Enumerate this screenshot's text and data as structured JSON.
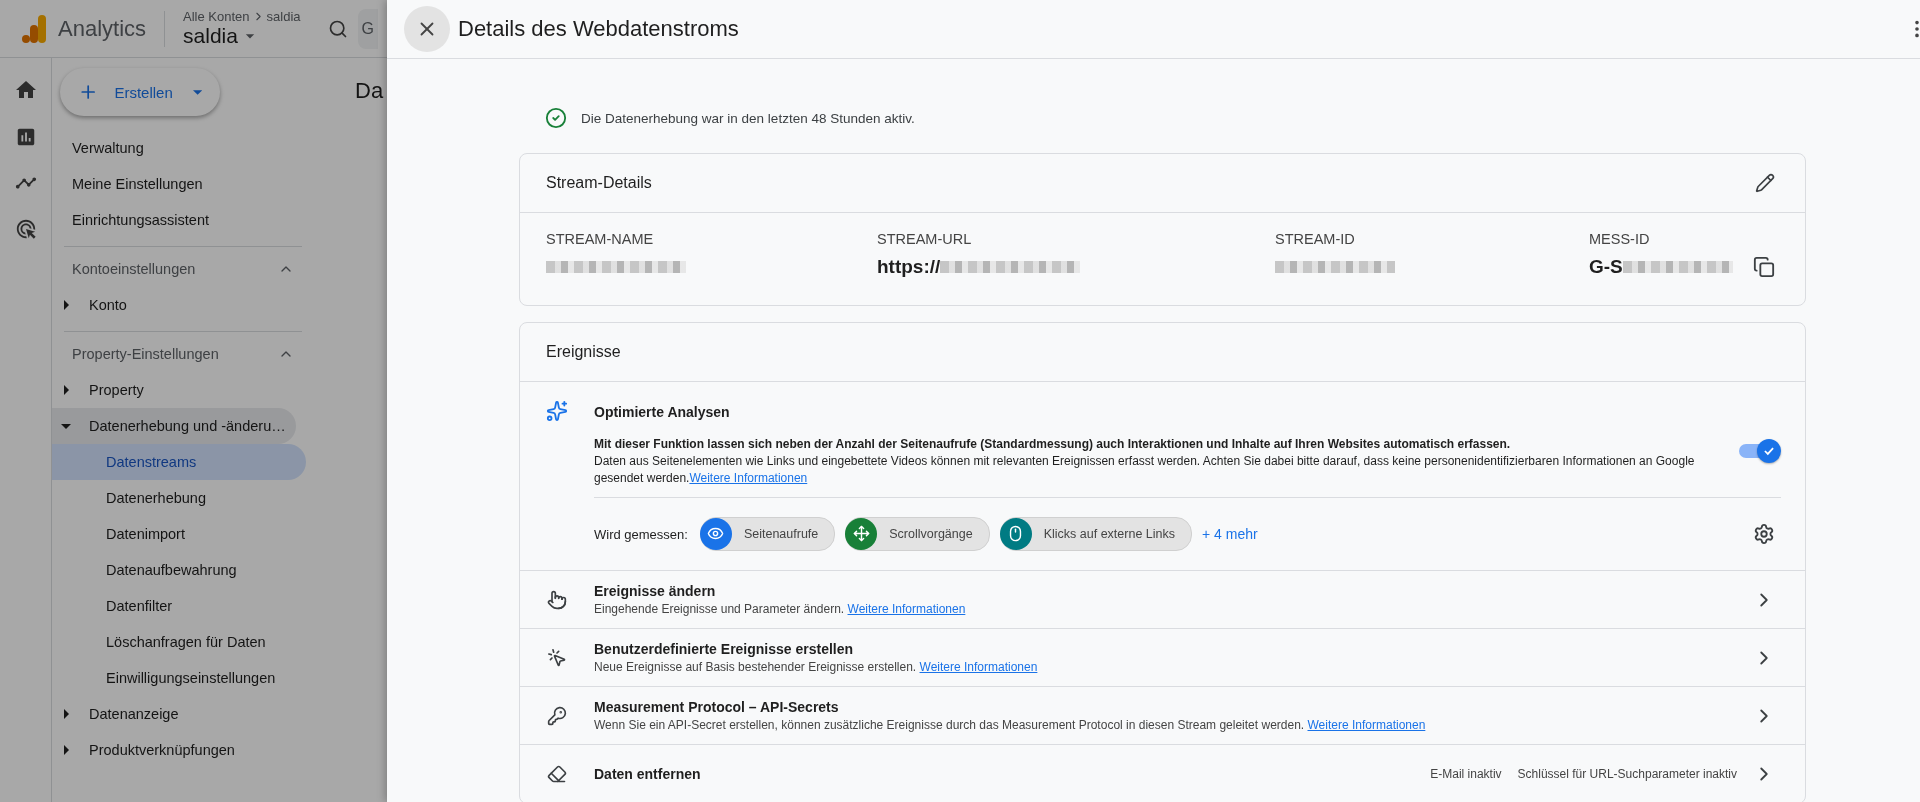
{
  "app": {
    "name": "Analytics",
    "breadcrumb": [
      "Alle Konten",
      "saldia"
    ],
    "property": "saldia",
    "search_fragment": "G"
  },
  "create_button": {
    "label": "Erstellen"
  },
  "nav": {
    "top_items": [
      "Verwaltung",
      "Meine Einstellungen",
      "Einrichtungsassistent"
    ],
    "sections": [
      {
        "title": "Kontoeinstellungen",
        "expanded": true,
        "items": [
          {
            "label": "Konto",
            "expanded": false
          }
        ]
      },
      {
        "title": "Property-Einstellungen",
        "expanded": true,
        "items": [
          {
            "label": "Property",
            "expanded": false
          },
          {
            "label": "Datenerhebung und -änderu…",
            "expanded": true,
            "children": [
              {
                "label": "Datenstreams",
                "selected": true
              },
              {
                "label": "Datenerhebung",
                "selected": false
              },
              {
                "label": "Datenimport",
                "selected": false
              },
              {
                "label": "Datenaufbewahrung",
                "selected": false
              },
              {
                "label": "Datenfilter",
                "selected": false
              },
              {
                "label": "Löschanfragen für Daten",
                "selected": false
              },
              {
                "label": "Einwilligungseinstellungen",
                "selected": false
              }
            ]
          },
          {
            "label": "Datenanzeige",
            "expanded": false
          },
          {
            "label": "Produktverknüpfungen",
            "expanded": false
          }
        ]
      }
    ]
  },
  "background_page": {
    "title_fragment": "Da"
  },
  "panel": {
    "title": "Details des Webdatenstroms",
    "status": "Die Datenerhebung war in den letzten 48 Stunden aktiv.",
    "stream_details": {
      "title": "Stream-Details",
      "fields": [
        {
          "label": "STREAM-NAME"
        },
        {
          "label": "STREAM-URL",
          "value": "https://"
        },
        {
          "label": "STREAM-ID"
        },
        {
          "label": "MESS-ID",
          "value": "G-S"
        }
      ]
    },
    "events": {
      "title": "Ereignisse",
      "enhanced": {
        "title": "Optimierte Analysen",
        "summary": "Mit dieser Funktion lassen sich neben der Anzahl der Seitenaufrufe (Standardmessung) auch Interaktionen und Inhalte auf Ihren Websites automatisch erfassen.",
        "details": "Daten aus Seitenelementen wie Links und eingebettete Videos können mit relevanten Ereignissen erfasst werden. Achten Sie dabei bitte darauf, dass keine personenidentifizierbaren Informationen an Google gesendet werden.",
        "link": "Weitere Informationen",
        "on": true,
        "measured_label": "Wird gemessen:",
        "chips": [
          {
            "label": "Seitenaufrufe",
            "color": "#1a73e8"
          },
          {
            "label": "Scrollvorgänge",
            "color": "#188038"
          },
          {
            "label": "Klicks auf externe Links",
            "color": "#007b83"
          }
        ],
        "more": "+ 4 mehr"
      },
      "rows": [
        {
          "title": "Ereignisse ändern",
          "description": "Eingehende Ereignisse und Parameter ändern.",
          "link": "Weitere Informationen"
        },
        {
          "title": "Benutzerdefinierte Ereignisse erstellen",
          "description": "Neue Ereignisse auf Basis bestehender Ereignisse erstellen.",
          "link": "Weitere Informationen"
        },
        {
          "title": "Measurement Protocol – API-Secrets",
          "description": "Wenn Sie ein API-Secret erstellen, können zusätzliche Ereignisse durch das Measurement Protocol in diesen Stream geleitet werden.",
          "link": "Weitere Informationen"
        },
        {
          "title": "Daten entfernen",
          "statuses": [
            "E-Mail inaktiv",
            "Schlüssel für URL-Suchparameter inaktiv"
          ]
        }
      ]
    }
  }
}
